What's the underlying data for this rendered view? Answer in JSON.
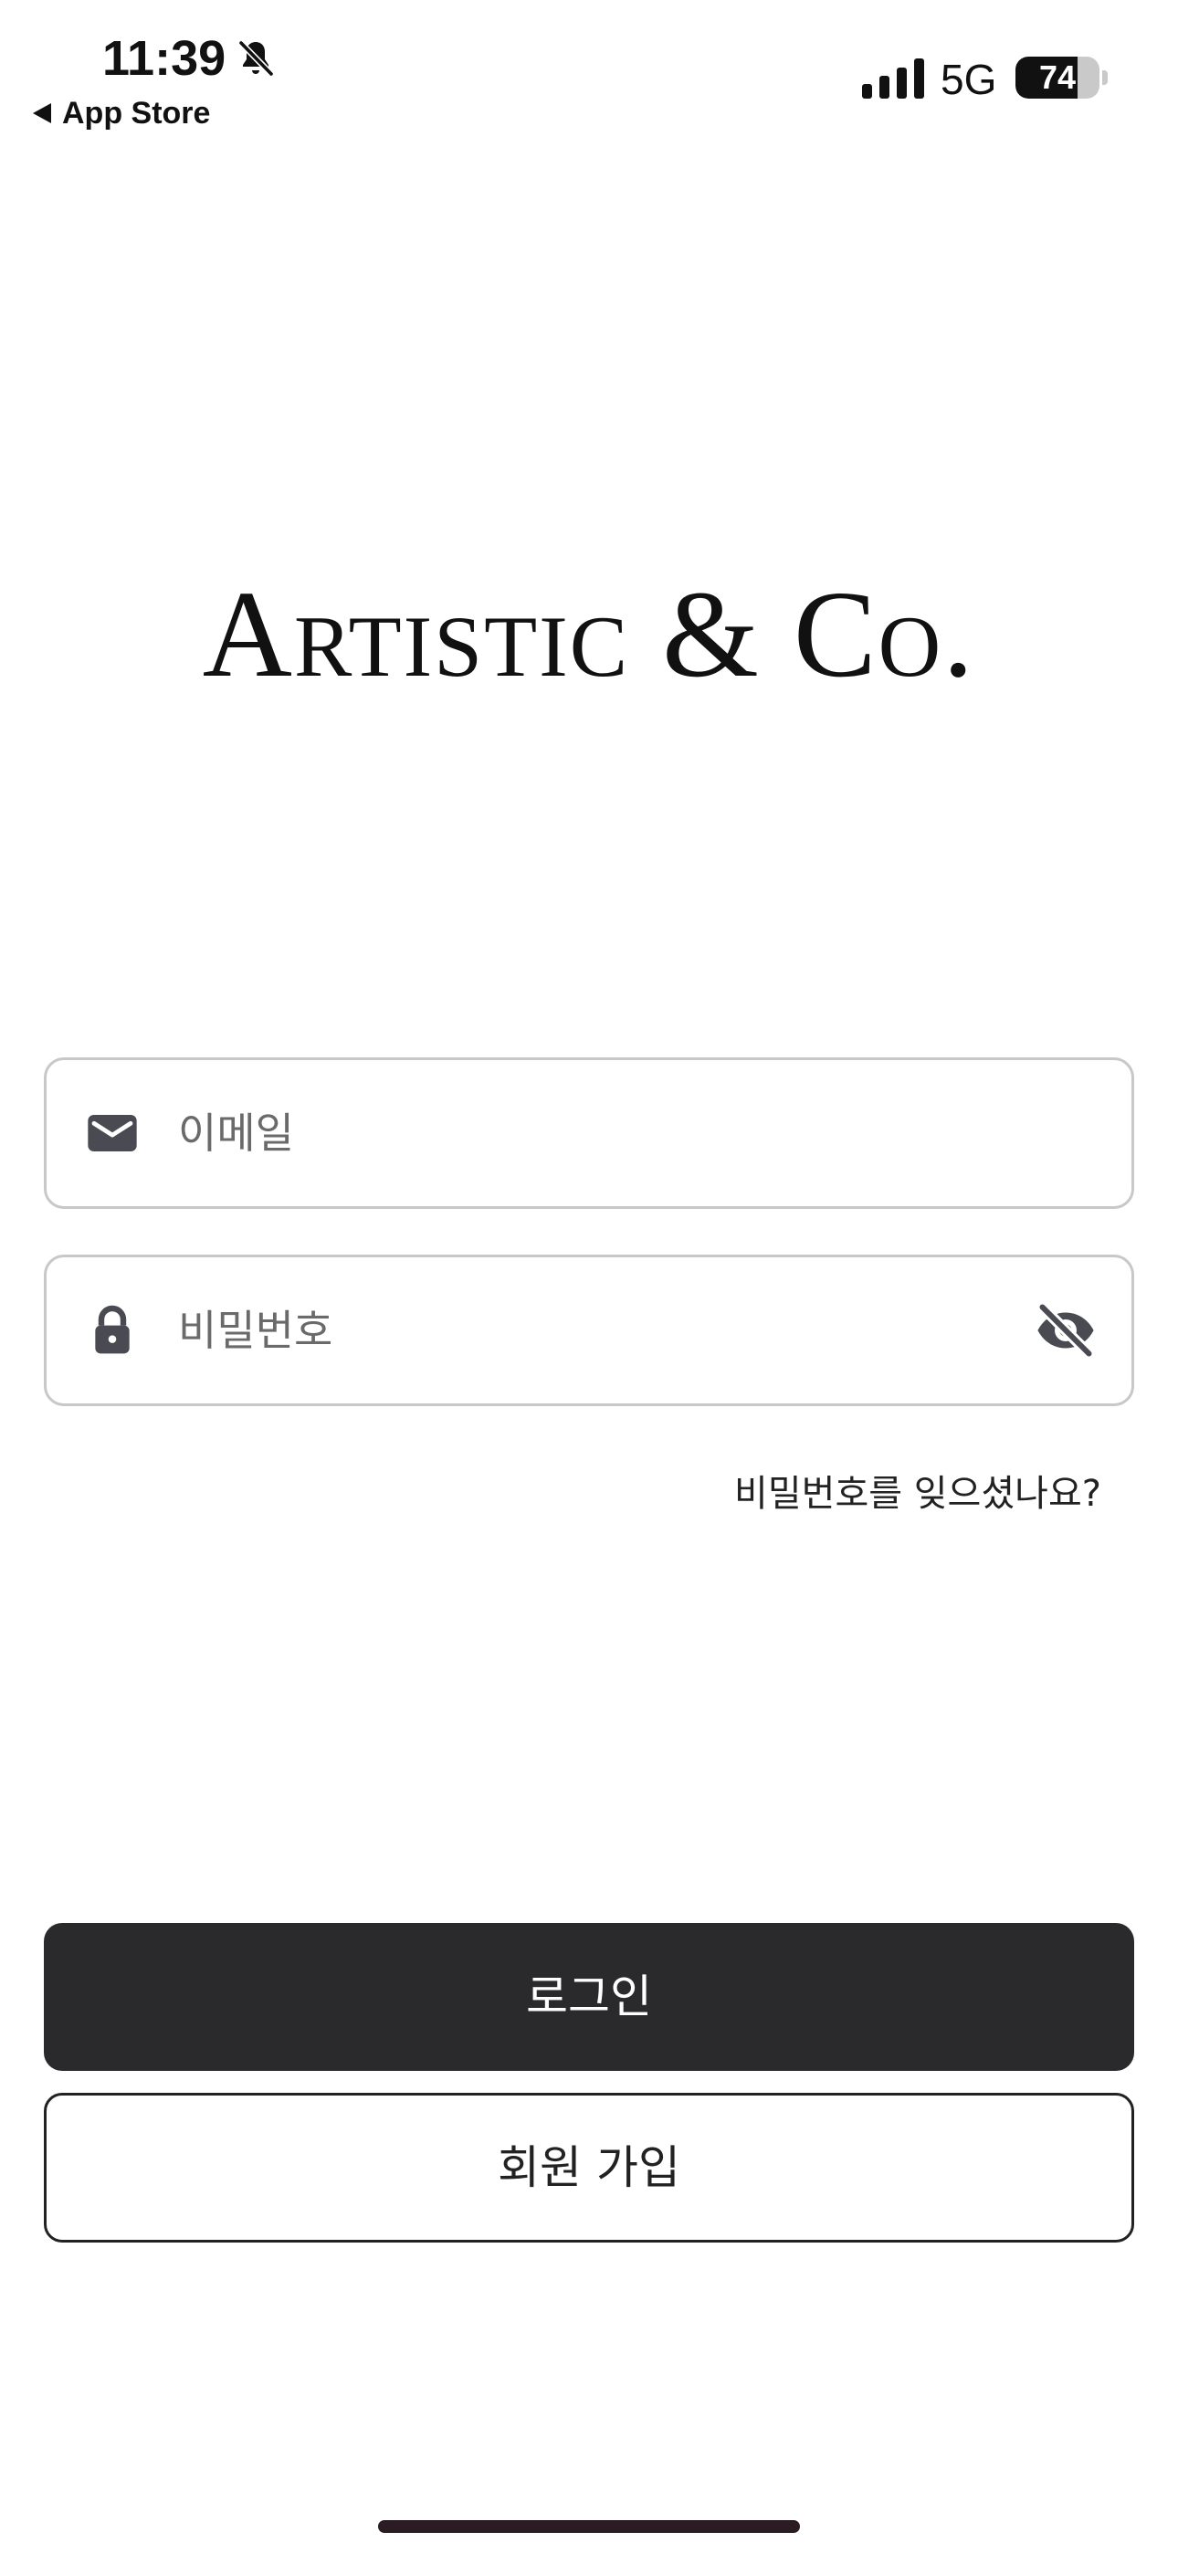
{
  "status_bar": {
    "time": "11:39",
    "back_label": "App Store",
    "network": "5G",
    "battery_percent": 74,
    "battery_label": "74",
    "signal_bars": 4,
    "silent_mode_icon": "bell-slash-icon"
  },
  "brand": {
    "logo_text": "Artistic & Co."
  },
  "login_form": {
    "email": {
      "placeholder": "이메일",
      "value": "",
      "icon": "envelope-icon"
    },
    "password": {
      "placeholder": "비밀번호",
      "value": "",
      "icon": "lock-icon",
      "toggle_icon": "eye-slash-icon"
    },
    "forgot_password_label": "비밀번호를 잊으셨나요?"
  },
  "actions": {
    "login_label": "로그인",
    "signup_label": "회원 가입"
  },
  "colors": {
    "primary_button": "#2a2a2c",
    "field_border": "#c8c8c8",
    "icon": "#4a4a52",
    "text": "#222222"
  }
}
